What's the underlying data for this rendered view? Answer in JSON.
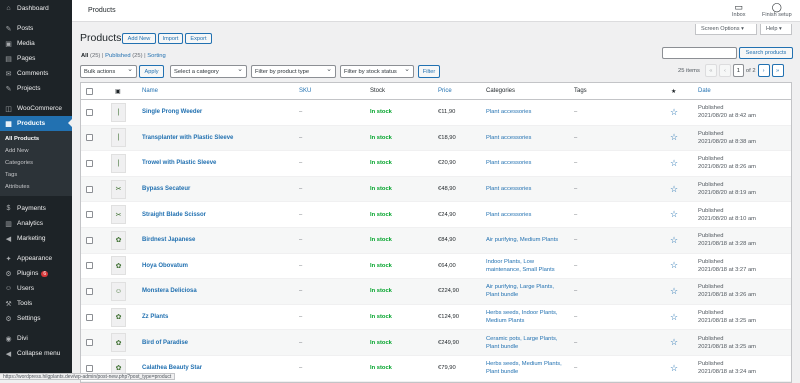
{
  "sidebar": {
    "items": [
      {
        "label": "Dashboard",
        "icon": "⌂"
      },
      {
        "label": "Posts",
        "icon": "✎"
      },
      {
        "label": "Media",
        "icon": "▣"
      },
      {
        "label": "Pages",
        "icon": "▤"
      },
      {
        "label": "Comments",
        "icon": "✉"
      },
      {
        "label": "Projects",
        "icon": "✎"
      },
      {
        "label": "WooCommerce",
        "icon": "◫"
      },
      {
        "label": "Products",
        "icon": "▦"
      },
      {
        "label": "Payments",
        "icon": "$"
      },
      {
        "label": "Analytics",
        "icon": "▥"
      },
      {
        "label": "Marketing",
        "icon": "◀"
      },
      {
        "label": "Appearance",
        "icon": "✦"
      },
      {
        "label": "Plugins",
        "icon": "⚙",
        "badge": "6"
      },
      {
        "label": "Users",
        "icon": "☺"
      },
      {
        "label": "Tools",
        "icon": "⚒"
      },
      {
        "label": "Settings",
        "icon": "⚙"
      },
      {
        "label": "Divi",
        "icon": "◉"
      },
      {
        "label": "Collapse menu",
        "icon": "◀"
      }
    ],
    "submenu": [
      "All Products",
      "Add New",
      "Categories",
      "Tags",
      "Attributes"
    ]
  },
  "topbar": {
    "title": "Products",
    "inbox": "Inbox",
    "finish_setup": "Finish setup",
    "screen_options": "Screen Options ▾",
    "help": "Help ▾"
  },
  "heading": {
    "title": "Products",
    "add_new": "Add New",
    "import": "Import",
    "export": "Export"
  },
  "views": {
    "all": "All",
    "all_count": "(25)",
    "published": "Published",
    "published_count": "(25)",
    "sorting": "Sorting",
    "sep": "|"
  },
  "search": {
    "button": "Search products"
  },
  "filters": {
    "bulk_actions": "Bulk actions",
    "apply": "Apply",
    "category": "Select a category",
    "product_type": "Filter by product type",
    "stock_status": "Filter by stock status",
    "filter": "Filter"
  },
  "pagination": {
    "items": "25 items",
    "first": "«",
    "prev": "‹",
    "current": "1",
    "of": "of 2",
    "next": "›",
    "last": "»"
  },
  "table": {
    "headers": {
      "thumb": "▣",
      "name": "Name",
      "sku": "SKU",
      "stock": "Stock",
      "price": "Price",
      "categories": "Categories",
      "tags": "Tags",
      "featured": "★",
      "date": "Date"
    },
    "rows": [
      {
        "name": "Single Prong Weeder",
        "sku": "–",
        "stock": "In stock",
        "price": "€11,90",
        "cat1": "Plant accessories",
        "cat2": "",
        "tags": "–",
        "status": "Published",
        "date": "2021/08/20 at 8:42 am",
        "thumb": "|"
      },
      {
        "name": "Transplanter with Plastic Sleeve",
        "sku": "–",
        "stock": "In stock",
        "price": "€18,90",
        "cat1": "Plant accessories",
        "cat2": "",
        "tags": "–",
        "status": "Published",
        "date": "2021/08/20 at 8:38 am",
        "thumb": "|"
      },
      {
        "name": "Trowel with Plastic Sleeve",
        "sku": "–",
        "stock": "In stock",
        "price": "€20,90",
        "cat1": "Plant accessories",
        "cat2": "",
        "tags": "–",
        "status": "Published",
        "date": "2021/08/20 at 8:26 am",
        "thumb": "|"
      },
      {
        "name": "Bypass Secateur",
        "sku": "–",
        "stock": "In stock",
        "price": "€48,90",
        "cat1": "Plant accessories",
        "cat2": "",
        "tags": "–",
        "status": "Published",
        "date": "2021/08/20 at 8:19 am",
        "thumb": "✂"
      },
      {
        "name": "Straight Blade Scissor",
        "sku": "–",
        "stock": "In stock",
        "price": "€24,90",
        "cat1": "Plant accessories",
        "cat2": "",
        "tags": "–",
        "status": "Published",
        "date": "2021/08/20 at 8:10 am",
        "thumb": "✂"
      },
      {
        "name": "Birdnest Japanese",
        "sku": "–",
        "stock": "In stock",
        "price": "€84,90",
        "cat1": "Air purifying, Medium Plants",
        "cat2": "",
        "tags": "–",
        "status": "Published",
        "date": "2021/08/18 at 3:28 am",
        "thumb": "✿"
      },
      {
        "name": "Hoya Obovatum",
        "sku": "–",
        "stock": "In stock",
        "price": "€64,00",
        "cat1": "Indoor Plants, Low",
        "cat2": "maintenance, Small Plants",
        "tags": "–",
        "status": "Published",
        "date": "2021/08/18 at 3:27 am",
        "thumb": "✿"
      },
      {
        "name": "Monstera Deliciosa",
        "sku": "–",
        "stock": "In stock",
        "price": "€224,90",
        "cat1": "Air purifying, Large Plants,",
        "cat2": "Plant bundle",
        "tags": "–",
        "status": "Published",
        "date": "2021/08/18 at 3:26 am",
        "thumb": "☺"
      },
      {
        "name": "Zz Plants",
        "sku": "–",
        "stock": "In stock",
        "price": "€124,90",
        "cat1": "Herbs seeds, Indoor Plants,",
        "cat2": "Medium Plants",
        "tags": "–",
        "status": "Published",
        "date": "2021/08/18 at 3:25 am",
        "thumb": "✿"
      },
      {
        "name": "Bird of Paradise",
        "sku": "–",
        "stock": "In stock",
        "price": "€249,90",
        "cat1": "Ceramic pots, Large Plants,",
        "cat2": "Plant bundle",
        "tags": "–",
        "status": "Published",
        "date": "2021/08/18 at 3:25 am",
        "thumb": "✿"
      },
      {
        "name": "Calathea Beauty Star",
        "sku": "–",
        "stock": "In stock",
        "price": "€79,90",
        "cat1": "Herbs seeds, Medium Plants,",
        "cat2": "Plant bundle",
        "tags": "–",
        "status": "Published",
        "date": "2021/08/18 at 3:24 am",
        "thumb": "✿"
      }
    ]
  },
  "statusbar": {
    "url": "https://wordpress.hilgplants.dev/wp-admin/post-new.php?post_type=product"
  }
}
